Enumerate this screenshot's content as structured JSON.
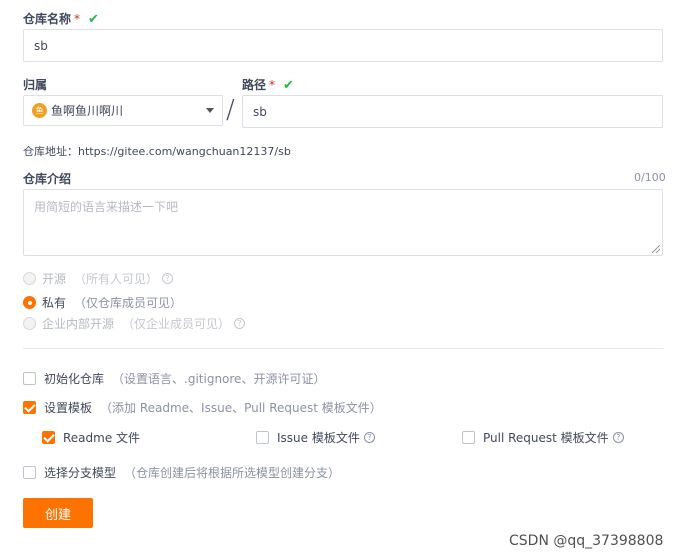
{
  "repo_name": {
    "label": "仓库名称",
    "required_mark": "*",
    "valid_mark": "✔",
    "value": "sb"
  },
  "owner": {
    "label": "归属",
    "avatar_text": "鱼",
    "selected": "鱼啊鱼川啊川"
  },
  "separator": "/",
  "path": {
    "label": "路径",
    "required_mark": "*",
    "valid_mark": "✔",
    "value": "sb"
  },
  "repo_address": "仓库地址：https://gitee.com/wangchuan12137/sb",
  "intro": {
    "label": "仓库介绍",
    "counter": "0/100",
    "placeholder": "用简短的语言来描述一下吧"
  },
  "visibility": {
    "options": [
      {
        "label": "开源",
        "hint": "（所有人可见）",
        "selected": false,
        "disabled": true,
        "help": "?"
      },
      {
        "label": "私有",
        "hint": "（仅仓库成员可见）",
        "selected": true,
        "disabled": false
      },
      {
        "label": "企业内部开源",
        "hint": "（仅企业成员可见）",
        "selected": false,
        "disabled": true,
        "help": "?"
      }
    ]
  },
  "init_repo": {
    "label": "初始化仓库",
    "hint": "（设置语言、.gitignore、开源许可证）",
    "checked": false
  },
  "templates": {
    "label": "设置模板",
    "hint": "（添加 Readme、Issue、Pull Request 模板文件）",
    "checked": true,
    "items": [
      {
        "label": "Readme 文件",
        "checked": true
      },
      {
        "label": "Issue 模板文件",
        "checked": false,
        "help": "?"
      },
      {
        "label": "Pull Request 模板文件",
        "checked": false,
        "help": "?"
      }
    ]
  },
  "branch_model": {
    "label": "选择分支模型",
    "hint": "（仓库创建后将根据所选模型创建分支）",
    "checked": false
  },
  "submit": {
    "label": "创建"
  },
  "watermark": "CSDN @qq_37398808",
  "colors": {
    "accent": "#fe7300",
    "valid": "#21ba45",
    "required": "#db2828"
  }
}
